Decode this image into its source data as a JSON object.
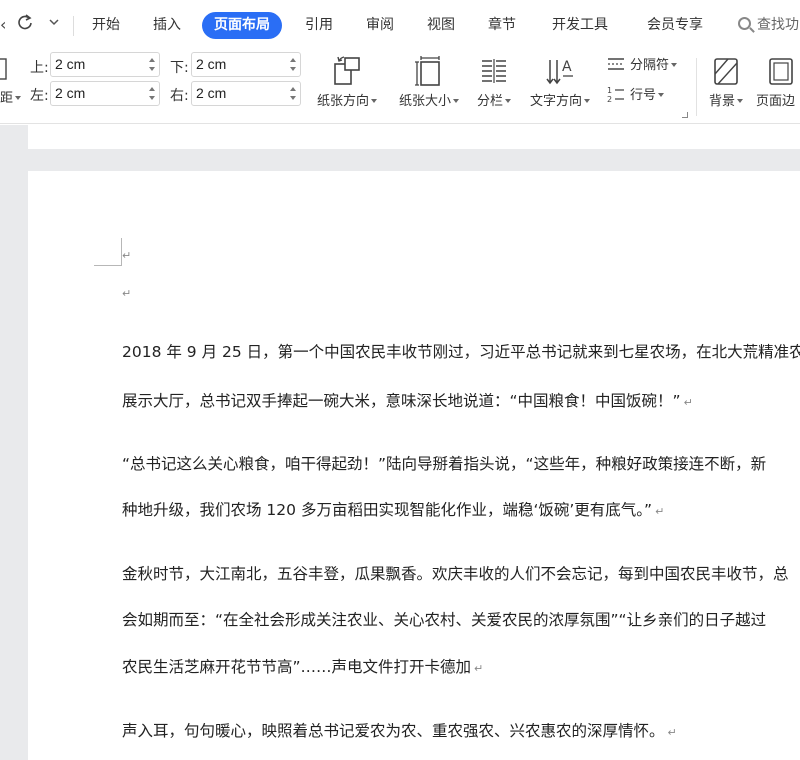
{
  "tabs": {
    "items": [
      "开始",
      "插入",
      "页面布局",
      "引用",
      "审阅",
      "视图",
      "章节",
      "开发工具",
      "会员专享"
    ],
    "active": "页面布局",
    "search_label": "查找功"
  },
  "toolbar": {
    "left_fragment_top": "-",
    "left_fragment_bottom": "距",
    "margins": {
      "top_label": "上:",
      "top_value": "2 cm",
      "bottom_label": "下:",
      "bottom_value": "2 cm",
      "left_label": "左:",
      "left_value": "2 cm",
      "right_label": "右:",
      "right_value": "2 cm"
    },
    "orientation": "纸张方向",
    "size": "纸张大小",
    "columns": "分栏",
    "text_direction": "文字方向",
    "breaks": "分隔符",
    "line_numbers": "行号",
    "background": "背景",
    "page_border": "页面边"
  },
  "document": {
    "para_mark": "↵",
    "lines": [
      "2018 年 9 月 25 日，第一个中国农民丰收节刚过，习近平总书记就来到七星农场，在北大荒精准农",
      "展示大厅，总书记双手捧起一碗大米，意味深长地说道：“中国粮食！中国饭碗！”",
      "“总书记这么关心粮食，咱干得起劲！”陆向导掰着指头说，“这些年，种粮好政策接连不断，新",
      "种地升级，我们农场 120 多万亩稻田实现智能化作业，端稳‘饭碗’更有底气。”",
      "金秋时节，大江南北，五谷丰登，瓜果飘香。欢庆丰收的人们不会忘记，每到中国农民丰收节，总",
      "会如期而至：“在全社会形成关注农业、关心农村、关爱农民的浓厚氛围”“让乡亲们的日子越过",
      "农民生活芝麻开花节节高”……声电文件打开卡德加",
      "声入耳，句句暖心，映照着总书记爱农为农、重农强农、兴农惠农的深厚情怀。"
    ]
  }
}
